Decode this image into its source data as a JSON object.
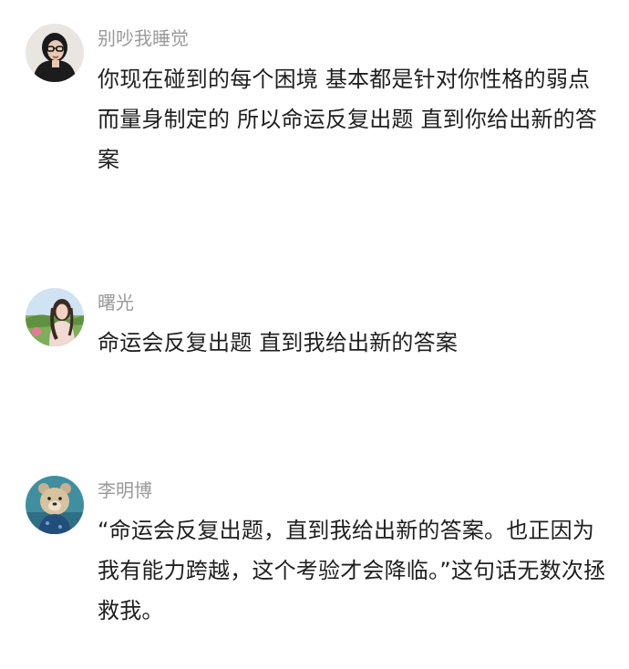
{
  "comments": [
    {
      "username": "别吵我睡觉",
      "avatar_icon": "woman-with-glasses-avatar",
      "text": "你现在碰到的每个困境 基本都是针对你性格的弱点而量身制定的 所以命运反复出题 直到你给出新的答案"
    },
    {
      "username": "曙光",
      "avatar_icon": "woman-outdoors-avatar",
      "text": "命运会反复出题 直到我给出新的答案"
    },
    {
      "username": "李明博",
      "avatar_icon": "teddy-bear-avatar",
      "text": "“命运会反复出题，直到我给出新的答案。也正因为我有能力跨越，这个考验才会降临。”这句话无数次拯救我。"
    }
  ],
  "colors": {
    "background": "#ffffff",
    "username": "#9a9a9a",
    "text": "#1f1f1f"
  }
}
